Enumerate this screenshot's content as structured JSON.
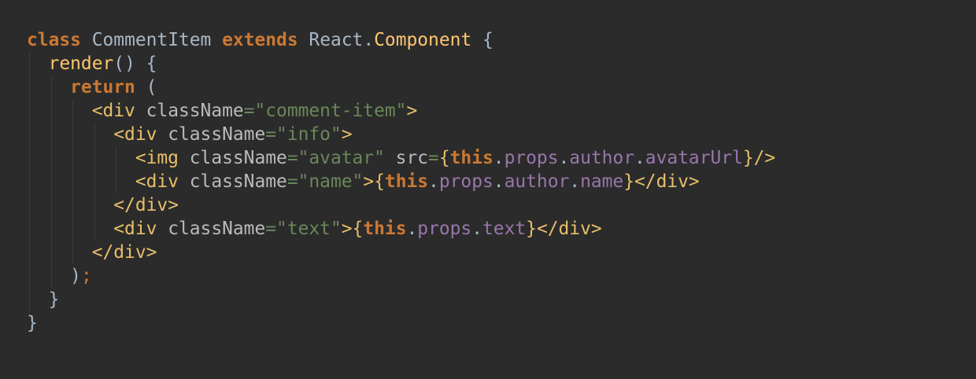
{
  "editor": {
    "theme": "dark",
    "background": "#2b2b2b",
    "colors": {
      "keyword": "#cc7832",
      "default_text": "#a9b7c6",
      "method_name": "#ffc66d",
      "jsx_tag": "#e8bf6a",
      "attribute": "#bababa",
      "string": "#6a8759",
      "property": "#9876aa"
    },
    "lines": [
      [
        {
          "t": "class",
          "k": "kw"
        },
        {
          "t": " ",
          "k": "punct"
        },
        {
          "t": "CommentItem",
          "k": "cls"
        },
        {
          "t": " ",
          "k": "punct"
        },
        {
          "t": "extends",
          "k": "kw"
        },
        {
          "t": " ",
          "k": "punct"
        },
        {
          "t": "React",
          "k": "cls"
        },
        {
          "t": ".",
          "k": "dot"
        },
        {
          "t": "Component",
          "k": "ext"
        },
        {
          "t": " {",
          "k": "punct"
        }
      ],
      [
        {
          "t": "  ",
          "k": "punct"
        },
        {
          "t": "render",
          "k": "fn"
        },
        {
          "t": "() {",
          "k": "punct"
        }
      ],
      [
        {
          "t": "    ",
          "k": "punct"
        },
        {
          "t": "return",
          "k": "kw"
        },
        {
          "t": " (",
          "k": "paren"
        }
      ],
      [
        {
          "t": "      ",
          "k": "punct"
        },
        {
          "t": "<div",
          "k": "tag"
        },
        {
          "t": " ",
          "k": "punct"
        },
        {
          "t": "className",
          "k": "attr"
        },
        {
          "t": "=",
          "k": "eq"
        },
        {
          "t": "\"comment-item\"",
          "k": "str"
        },
        {
          "t": ">",
          "k": "tag"
        }
      ],
      [
        {
          "t": "        ",
          "k": "punct"
        },
        {
          "t": "<div",
          "k": "tag"
        },
        {
          "t": " ",
          "k": "punct"
        },
        {
          "t": "className",
          "k": "attr"
        },
        {
          "t": "=",
          "k": "eq"
        },
        {
          "t": "\"info\"",
          "k": "str"
        },
        {
          "t": ">",
          "k": "tag"
        }
      ],
      [
        {
          "t": "          ",
          "k": "punct"
        },
        {
          "t": "<img",
          "k": "tag"
        },
        {
          "t": " ",
          "k": "punct"
        },
        {
          "t": "className",
          "k": "attr"
        },
        {
          "t": "=",
          "k": "eq"
        },
        {
          "t": "\"avatar\"",
          "k": "str"
        },
        {
          "t": " ",
          "k": "punct"
        },
        {
          "t": "src",
          "k": "attr"
        },
        {
          "t": "=",
          "k": "eq"
        },
        {
          "t": "{",
          "k": "brace"
        },
        {
          "t": "this",
          "k": "this"
        },
        {
          "t": ".",
          "k": "dot"
        },
        {
          "t": "props",
          "k": "prop"
        },
        {
          "t": ".",
          "k": "dot"
        },
        {
          "t": "author",
          "k": "prop"
        },
        {
          "t": ".",
          "k": "dot"
        },
        {
          "t": "avatarUrl",
          "k": "prop"
        },
        {
          "t": "}",
          "k": "brace"
        },
        {
          "t": "/>",
          "k": "tag"
        }
      ],
      [
        {
          "t": "          ",
          "k": "punct"
        },
        {
          "t": "<div",
          "k": "tag"
        },
        {
          "t": " ",
          "k": "punct"
        },
        {
          "t": "className",
          "k": "attr"
        },
        {
          "t": "=",
          "k": "eq"
        },
        {
          "t": "\"name\"",
          "k": "str"
        },
        {
          "t": ">",
          "k": "tag"
        },
        {
          "t": "{",
          "k": "brace"
        },
        {
          "t": "this",
          "k": "this"
        },
        {
          "t": ".",
          "k": "dot"
        },
        {
          "t": "props",
          "k": "prop"
        },
        {
          "t": ".",
          "k": "dot"
        },
        {
          "t": "author",
          "k": "prop"
        },
        {
          "t": ".",
          "k": "dot"
        },
        {
          "t": "name",
          "k": "prop"
        },
        {
          "t": "}",
          "k": "brace"
        },
        {
          "t": "</div>",
          "k": "tag"
        }
      ],
      [
        {
          "t": "        ",
          "k": "punct"
        },
        {
          "t": "</div>",
          "k": "tag"
        }
      ],
      [
        {
          "t": "        ",
          "k": "punct"
        },
        {
          "t": "<div",
          "k": "tag"
        },
        {
          "t": " ",
          "k": "punct"
        },
        {
          "t": "className",
          "k": "attr"
        },
        {
          "t": "=",
          "k": "eq"
        },
        {
          "t": "\"text\"",
          "k": "str"
        },
        {
          "t": ">",
          "k": "tag"
        },
        {
          "t": "{",
          "k": "brace"
        },
        {
          "t": "this",
          "k": "this"
        },
        {
          "t": ".",
          "k": "dot"
        },
        {
          "t": "props",
          "k": "prop"
        },
        {
          "t": ".",
          "k": "dot"
        },
        {
          "t": "text",
          "k": "prop"
        },
        {
          "t": "}",
          "k": "brace"
        },
        {
          "t": "</div>",
          "k": "tag"
        }
      ],
      [
        {
          "t": "      ",
          "k": "punct"
        },
        {
          "t": "</div>",
          "k": "tag"
        }
      ],
      [
        {
          "t": "    ",
          "k": "punct"
        },
        {
          "t": ")",
          "k": "paren"
        },
        {
          "t": ";",
          "k": "semi"
        }
      ],
      [
        {
          "t": "  ",
          "k": "punct"
        },
        {
          "t": "}",
          "k": "punct"
        }
      ],
      [
        {
          "t": "}",
          "k": "punct"
        }
      ]
    ]
  }
}
